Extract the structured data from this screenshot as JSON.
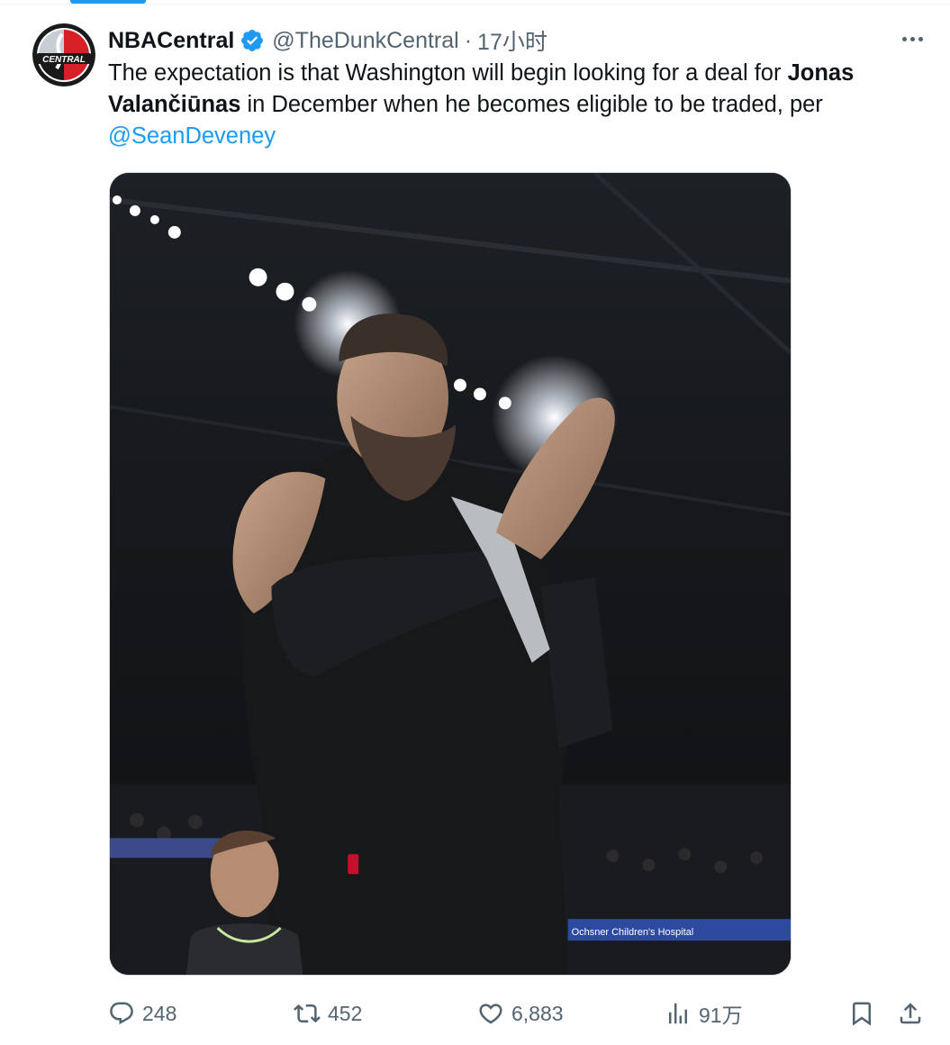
{
  "tweet": {
    "author": {
      "display_name": "NBACentral",
      "handle": "@TheDunkCentral",
      "verified": true,
      "avatar_text": "CENTRAL"
    },
    "separator": "·",
    "timestamp": "17小时",
    "text": {
      "part1": "The expectation is that Washington will begin looking for a deal for ",
      "bold_name": "Jonas Valančiūnas",
      "part2": " in December when he becomes eligible to be traded, per ",
      "mention": "@SeanDeveney"
    },
    "media": {
      "arena_banner_text": "Ochsner Children's Hospital"
    },
    "stats": {
      "replies": "248",
      "reposts": "452",
      "likes": "6,883",
      "views": "91万"
    }
  },
  "colors": {
    "accent": "#1d9bf0",
    "secondary_text": "#536471",
    "primary_text": "#0f1419"
  },
  "icons": [
    "verified-badge-icon",
    "more-icon",
    "reply-icon",
    "repost-icon",
    "like-icon",
    "views-icon",
    "bookmark-icon",
    "share-icon"
  ]
}
